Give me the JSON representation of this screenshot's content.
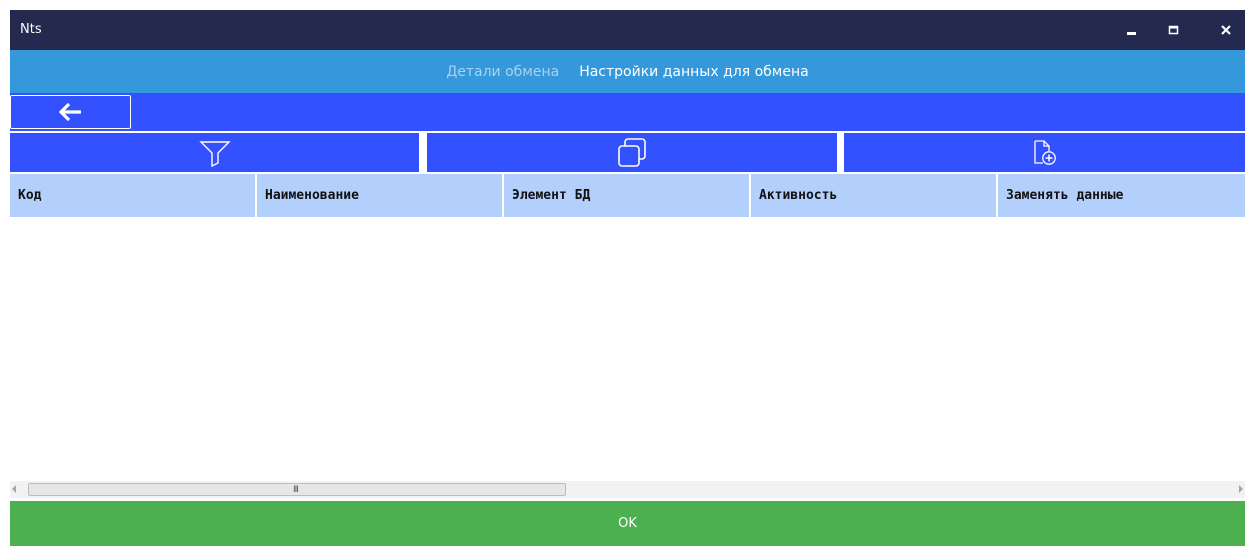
{
  "window": {
    "title": "Nts",
    "controls": [
      "minimize-icon",
      "maximize-icon",
      "close-icon"
    ]
  },
  "tabs": [
    {
      "label": "Детали обмена",
      "active": false
    },
    {
      "label": "Настройки данных для обмена",
      "active": true
    }
  ],
  "nav": {
    "back_icon": "arrow-left-icon"
  },
  "toolbar": {
    "buttons": [
      {
        "icon": "filter-icon"
      },
      {
        "icon": "copy-icon"
      },
      {
        "icon": "add-document-icon"
      }
    ]
  },
  "grid": {
    "columns": [
      "Код",
      "Наименование",
      "Элемент БД",
      "Активность",
      "Заменять данные"
    ],
    "rows": []
  },
  "scrollbar": {
    "grip": "III"
  },
  "footer": {
    "ok_label": "OK"
  },
  "colors": {
    "titlebar": "#23294f",
    "tabbar": "#3498db",
    "toolbar": "#3451ff",
    "header": "#b3cffb",
    "ok": "#4caf50"
  }
}
